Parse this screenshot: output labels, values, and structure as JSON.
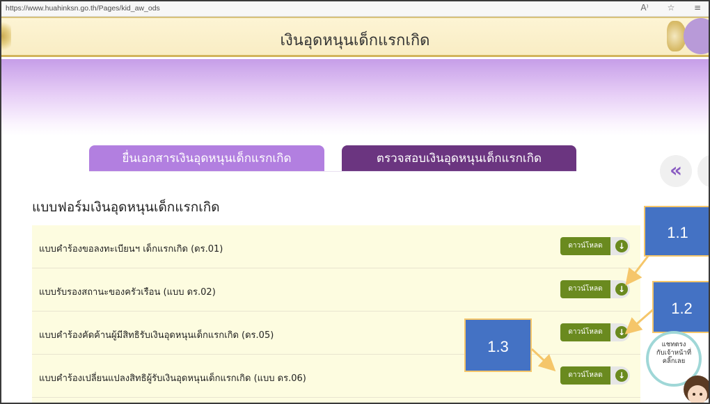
{
  "browser": {
    "url": "https://www.huahinksn.go.th/Pages/kid_aw_ods"
  },
  "header": {
    "title": "เงินอุดหนุนเด็กแรกเกิด"
  },
  "tabs": [
    {
      "label": "ยื่นเอกสารเงินอุดหนุนเด็กแรกเกิด",
      "color": "#b27fe0"
    },
    {
      "label": "ตรวจสอบเงินอุดหนุนเด็กแรกเกิด",
      "color": "#6b3580"
    }
  ],
  "section": {
    "heading": "แบบฟอร์มเงินอุดหนุนเด็กแรกเกิด"
  },
  "forms": [
    {
      "label": "แบบคำร้องขอลงทะเบียนฯ เด็กแรกเกิด (ดร.01)",
      "button": "ดาวน์โหลด"
    },
    {
      "label": "แบบรับรองสถานะของครัวเรือน (แบบ ดร.02)",
      "button": "ดาวน์โหลด"
    },
    {
      "label": "แบบคำร้องคัดค้านผู้มีสิทธิรับเงินอุดหนุนเด็กแรกเกิด (ดร.05)",
      "button": "ดาวน์โหลด"
    },
    {
      "label": "แบบคำร้องเปลี่ยนแปลงสิทธิผู้รับเงินอุดหนุนเด็กแรกเกิด (แบบ ดร.06)",
      "button": "ดาวน์โหลด"
    }
  ],
  "callouts": {
    "c1": "1.1",
    "c2": "1.2",
    "c3": "1.3"
  },
  "chat": {
    "line1": "แชทตรง",
    "line2": "กับเจ้าหน้าที่",
    "line3": "คลิ๊กเลย"
  },
  "colors": {
    "accent_purple": "#b27fe0",
    "dark_purple": "#6b3580",
    "download_green": "#6a8a1f",
    "callout_blue": "#4472c4",
    "callout_border": "#f5c66a"
  }
}
